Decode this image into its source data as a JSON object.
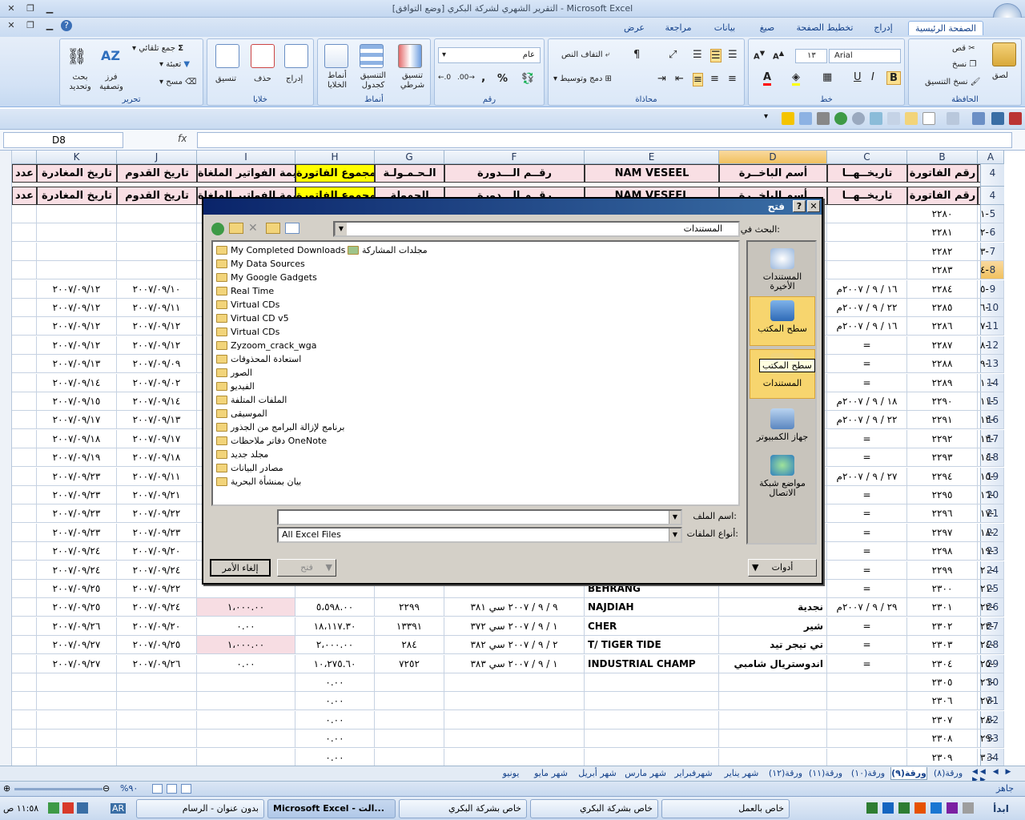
{
  "window": {
    "title": "التقرير الشهري لشركة البكري  [وضع التوافق] - Microsoft Excel"
  },
  "ribbon": {
    "tabs": [
      "الصفحة الرئيسية",
      "إدراج",
      "تخطيط الصفحة",
      "صيغ",
      "بيانات",
      "مراجعة",
      "عرض"
    ],
    "groups": {
      "clipboard": {
        "label": "الحافظة",
        "paste": "لصق",
        "cut": "قص",
        "copy": "نسخ",
        "format_painter": "نسخ التنسيق"
      },
      "font": {
        "label": "خط",
        "font_name": "Arial",
        "font_size": "١٣"
      },
      "alignment": {
        "label": "محاذاة",
        "wrap": "التفاف النص",
        "merge": "دمج وتوسيط"
      },
      "number": {
        "label": "رقم",
        "format": "عام",
        "percent": "%",
        "comma": ","
      },
      "styles": {
        "label": "أنماط",
        "conditional": "تنسيق شرطي",
        "table": "التنسيق كجدول",
        "cell_styles": "أنماط الخلايا"
      },
      "cells": {
        "label": "خلايا",
        "insert": "إدراج",
        "delete": "حذف",
        "format": "تنسيق"
      },
      "editing": {
        "label": "تحرير",
        "autosum": "جمع تلقائي",
        "fill": "تعبئة",
        "clear": "مسح",
        "sort": "فرز وتصفية",
        "find": "بحث وتحديد"
      }
    }
  },
  "formula_bar": {
    "name_box": "D8",
    "fx": "fx"
  },
  "sheet": {
    "columns": [
      "A",
      "B",
      "C",
      "D",
      "E",
      "F",
      "G",
      "H",
      "I",
      "J",
      "K"
    ],
    "frozen_header": [
      "م",
      "رقم الفاتورة",
      "تاريخــهــا",
      "أسم الباخــرة",
      "NAM VESEEL",
      "رقــم الـــدورة",
      "الـحـمـولـة",
      "مجموع الفاتورة",
      "قيمة الفواتير الملغاة",
      "تاريخ القدوم",
      "تاريخ المغادرة",
      "عدد"
    ],
    "header_row2": [
      "م",
      "رقم الفاتورة",
      "تاريخــهــا",
      "أسم الباخــرة",
      "NAM VESEEL",
      "رقــم الـــدورة",
      "الحمولة",
      "مجموع الفاتورة",
      "قيمة الفواتير الملغاة",
      "تاريخ القدوم",
      "تاريخ المغادرة",
      "عدد"
    ],
    "row_numbers": [
      "4",
      "4",
      "5",
      "6",
      "7",
      "8",
      "9",
      "10",
      "11",
      "12",
      "13",
      "14",
      "15",
      "16",
      "17",
      "18",
      "19",
      "20",
      "21",
      "22",
      "23",
      "24",
      "25",
      "26",
      "27",
      "28",
      "29",
      "30",
      "31",
      "32",
      "33",
      "34"
    ],
    "rows": [
      {
        "a": "١-",
        "b": "٢٢٨٠",
        "c": "",
        "d": "",
        "e": "",
        "f": "",
        "g": "",
        "h": "",
        "i": "",
        "j": "",
        "k": ""
      },
      {
        "a": "٢-",
        "b": "٢٢٨١",
        "c": "",
        "d": "",
        "e": "",
        "f": "",
        "g": "",
        "h": "",
        "i": "",
        "j": "",
        "k": ""
      },
      {
        "a": "٣-",
        "b": "٢٢٨٢",
        "c": "",
        "d": "",
        "e": "",
        "f": "",
        "g": "",
        "h": "",
        "i": "",
        "j": "",
        "k": ""
      },
      {
        "a": "٤-",
        "b": "٢٢٨٣",
        "c": "",
        "d": "",
        "e": "",
        "f": "",
        "g": "",
        "h": "",
        "i": "",
        "j": "",
        "k": ""
      },
      {
        "a": "٥-",
        "b": "٢٢٨٤",
        "c": "١٦ / ٩ / ٢٠٠٧م",
        "d": "",
        "e": "",
        "f": "",
        "g": "",
        "h": "",
        "i": "",
        "j": "٢٠٠٧/٠٩/١٠",
        "k": "٢٠٠٧/٠٩/١٢"
      },
      {
        "a": "٦-",
        "b": "٢٢٨٥",
        "c": "٢٢ / ٩ / ٢٠٠٧م",
        "d": "",
        "e": "",
        "f": "",
        "g": "",
        "h": "",
        "i": "",
        "j": "٢٠٠٧/٠٩/١١",
        "k": "٢٠٠٧/٠٩/١٢"
      },
      {
        "a": "٧-",
        "b": "٢٢٨٦",
        "c": "١٦ / ٩ / ٢٠٠٧م",
        "d": "",
        "e": "",
        "f": "",
        "g": "",
        "h": "",
        "i": "",
        "j": "٢٠٠٧/٠٩/١٢",
        "k": "٢٠٠٧/٠٩/١٢"
      },
      {
        "a": "٨-",
        "b": "٢٢٨٧",
        "c": "=",
        "d": "",
        "e": "",
        "f": "",
        "g": "",
        "h": "",
        "i": "",
        "j": "٢٠٠٧/٠٩/١٢",
        "k": "٢٠٠٧/٠٩/١٢"
      },
      {
        "a": "٩-",
        "b": "٢٢٨٨",
        "c": "=",
        "d": "",
        "e": "",
        "f": "",
        "g": "",
        "h": "",
        "i": "",
        "j": "٢٠٠٧/٠٩/٠٩",
        "k": "٢٠٠٧/٠٩/١٣"
      },
      {
        "a": "١٠-",
        "b": "٢٢٨٩",
        "c": "=",
        "d": "",
        "e": "",
        "f": "",
        "g": "",
        "h": "",
        "i": "",
        "j": "٢٠٠٧/٠٩/٠٢",
        "k": "٢٠٠٧/٠٩/١٤"
      },
      {
        "a": "١١-",
        "b": "٢٢٩٠",
        "c": "١٨ / ٩ / ٢٠٠٧م",
        "d": "",
        "e": "",
        "f": "",
        "g": "",
        "h": "",
        "i": "",
        "j": "٢٠٠٧/٠٩/١٤",
        "k": "٢٠٠٧/٠٩/١٥"
      },
      {
        "a": "١٢-",
        "b": "٢٢٩١",
        "c": "٢٢ / ٩ / ٢٠٠٧م",
        "d": "",
        "e": "",
        "f": "",
        "g": "",
        "h": "",
        "i": "",
        "j": "٢٠٠٧/٠٩/١٣",
        "k": "٢٠٠٧/٠٩/١٧"
      },
      {
        "a": "١٣-",
        "b": "٢٢٩٢",
        "c": "=",
        "d": "",
        "e": "",
        "f": "",
        "g": "",
        "h": "",
        "i": "",
        "j": "٢٠٠٧/٠٩/١٧",
        "k": "٢٠٠٧/٠٩/١٨"
      },
      {
        "a": "١٤-",
        "b": "٢٢٩٣",
        "c": "=",
        "d": "",
        "e": "",
        "f": "",
        "g": "",
        "h": "",
        "i": "",
        "j": "٢٠٠٧/٠٩/١٨",
        "k": "٢٠٠٧/٠٩/١٩"
      },
      {
        "a": "١٥-",
        "b": "٢٢٩٤",
        "c": "٢٧ / ٩ / ٢٠٠٧م",
        "d": "",
        "e": "",
        "f": "",
        "g": "",
        "h": "",
        "i": "",
        "j": "٢٠٠٧/٠٩/١١",
        "k": "٢٠٠٧/٠٩/٢٣"
      },
      {
        "a": "١٦-",
        "b": "٢٢٩٥",
        "c": "=",
        "d": "",
        "e": "",
        "f": "",
        "g": "",
        "h": "",
        "i": "",
        "j": "٢٠٠٧/٠٩/٢١",
        "k": "٢٠٠٧/٠٩/٢٣"
      },
      {
        "a": "١٧-",
        "b": "٢٢٩٦",
        "c": "=",
        "d": "",
        "e": "",
        "f": "",
        "g": "",
        "h": "",
        "i": "",
        "j": "٢٠٠٧/٠٩/٢٢",
        "k": "٢٠٠٧/٠٩/٢٣"
      },
      {
        "a": "١٨-",
        "b": "٢٢٩٧",
        "c": "=",
        "d": "",
        "e": "",
        "f": "",
        "g": "",
        "h": "",
        "i": "",
        "j": "٢٠٠٧/٠٩/٢٣",
        "k": "٢٠٠٧/٠٩/٢٣"
      },
      {
        "a": "١٩-",
        "b": "٢٢٩٨",
        "c": "=",
        "d": "",
        "e": "",
        "f": "",
        "g": "",
        "h": "",
        "i": "",
        "j": "٢٠٠٧/٠٩/٢٠",
        "k": "٢٠٠٧/٠٩/٢٤"
      },
      {
        "a": "٢٠-",
        "b": "٢٢٩٩",
        "c": "=",
        "d": "",
        "e": "",
        "f": "",
        "g": "",
        "h": "",
        "i": "",
        "j": "٢٠٠٧/٠٩/٢٤",
        "k": "٢٠٠٧/٠٩/٢٤"
      },
      {
        "a": "٢١-",
        "b": "٢٣٠٠",
        "c": "=",
        "d": "",
        "e": "BEHRANG",
        "f": "",
        "g": "",
        "h": "",
        "i": "",
        "j": "٢٠٠٧/٠٩/٢٢",
        "k": "٢٠٠٧/٠٩/٢٥"
      },
      {
        "a": "٢٢-",
        "b": "٢٣٠١",
        "c": "٢٩ / ٩ / ٢٠٠٧م",
        "d": "نجدية",
        "e": "NAJDIAH",
        "f": "٩ / ٩ / ٢٠٠٧ سي ٣٨١",
        "g": "٢٢٩٩",
        "h": "٥،٥٩٨.٠٠",
        "i": "١،٠٠٠.٠٠",
        "j": "٢٠٠٧/٠٩/٢٤",
        "k": "٢٠٠٧/٠٩/٢٥"
      },
      {
        "a": "٢٣-",
        "b": "٢٣٠٢",
        "c": "=",
        "d": "شير",
        "e": "CHER",
        "f": "١ / ٩ / ٢٠٠٧ سي ٣٧٢",
        "g": "١٣٣٩١",
        "h": "١٨،١١٧.٣٠",
        "i": "٠.٠٠",
        "j": "٢٠٠٧/٠٩/٢٠",
        "k": "٢٠٠٧/٠٩/٢٦"
      },
      {
        "a": "٢٤-",
        "b": "٢٣٠٣",
        "c": "=",
        "d": "تي تيجر تيد",
        "e": "T/ TIGER TIDE",
        "f": "٢ / ٩ / ٢٠٠٧ سي ٣٨٢",
        "g": "٢٨٤",
        "h": "٢،٠٠٠.٠٠",
        "i": "١،٠٠٠.٠٠",
        "j": "٢٠٠٧/٠٩/٢٥",
        "k": "٢٠٠٧/٠٩/٢٧"
      },
      {
        "a": "٢٥-",
        "b": "٢٣٠٤",
        "c": "=",
        "d": "اندوستريال شامبي",
        "e": "INDUSTRIAL CHAMP",
        "f": "١ / ٩ / ٢٠٠٧ سي ٣٨٣",
        "g": "٧٢٥٢",
        "h": "١٠،٢٧٥.٦٠",
        "i": "٠.٠٠",
        "j": "٢٠٠٧/٠٩/٢٦",
        "k": "٢٠٠٧/٠٩/٢٧"
      },
      {
        "a": "٢٦-",
        "b": "٢٣٠٥",
        "c": "",
        "d": "",
        "e": "",
        "f": "",
        "g": "",
        "h": "٠.٠٠",
        "i": "",
        "j": "",
        "k": ""
      },
      {
        "a": "٢٧-",
        "b": "٢٣٠٦",
        "c": "",
        "d": "",
        "e": "",
        "f": "",
        "g": "",
        "h": "٠.٠٠",
        "i": "",
        "j": "",
        "k": ""
      },
      {
        "a": "٢٨-",
        "b": "٢٣٠٧",
        "c": "",
        "d": "",
        "e": "",
        "f": "",
        "g": "",
        "h": "٠.٠٠",
        "i": "",
        "j": "",
        "k": ""
      },
      {
        "a": "٢٩-",
        "b": "٢٣٠٨",
        "c": "",
        "d": "",
        "e": "",
        "f": "",
        "g": "",
        "h": "٠.٠٠",
        "i": "",
        "j": "",
        "k": ""
      },
      {
        "a": "٣٠-",
        "b": "٢٣٠٩",
        "c": "",
        "d": "",
        "e": "",
        "f": "",
        "g": "",
        "h": "٠.٠٠",
        "i": "",
        "j": "",
        "k": ""
      }
    ],
    "tabs": [
      "ورقة(٨)",
      "ورقة(٩)",
      "ورقة(١٠)",
      "ورقة(١١)",
      "ورقة(١٢)",
      "شهر يناير",
      "شهرفبراير",
      "شهر مارس",
      "شهر أبريل",
      "شهر مايو",
      "يونيو"
    ],
    "active_tab": "ورقة(٩)"
  },
  "status": {
    "ready": "جاهز",
    "zoom": "%٩٠"
  },
  "dialog": {
    "title": "فتح",
    "look_in_label": "البحث في:",
    "look_in_value": "المستندات",
    "files": [
      "My Completed Downloads",
      "My Data Sources",
      "My Google Gadgets",
      "Real Time",
      "Virtual  CDs",
      "Virtual CD v5",
      "Virtual CDs",
      "Zyzoom_crack_wga",
      "استعادة المحذوفات",
      "الصور",
      "الفيديو",
      "الملفات المتلفة",
      "الموسيقى",
      "برنامج لإزالة البرامج من الجذور",
      "دفاتر ملاحظات OneNote",
      "مجلد جديد",
      "مصادر البيانات",
      "بيان بمنشأة البحرية"
    ],
    "shared_folder": "مجلدات المشاركة",
    "places": [
      "المستندات الأخيرة",
      "سطح المكتب",
      "المستندات",
      "جهاز الكمبيوتر",
      "مواضع شبكة الاتصال"
    ],
    "tooltip": "سطح المكتب",
    "filename_label": "اسم الملف:",
    "filename_value": "",
    "filetype_label": "أنواع الملفات:",
    "filetype_value": "All Excel Files",
    "tools_button": "أدوات",
    "open_button": "فتح",
    "cancel_button": "إلغاء الأمر"
  },
  "taskbar": {
    "start": "ابدأ",
    "buttons": [
      "خاص بالعمل",
      "خاص بشركة البكري",
      "خاص بشركة البكري",
      "Microsoft Excel - الت...",
      "بدون عنوان - الرسام"
    ],
    "lang": "AR",
    "clock": "١١:٥٨ ص"
  }
}
